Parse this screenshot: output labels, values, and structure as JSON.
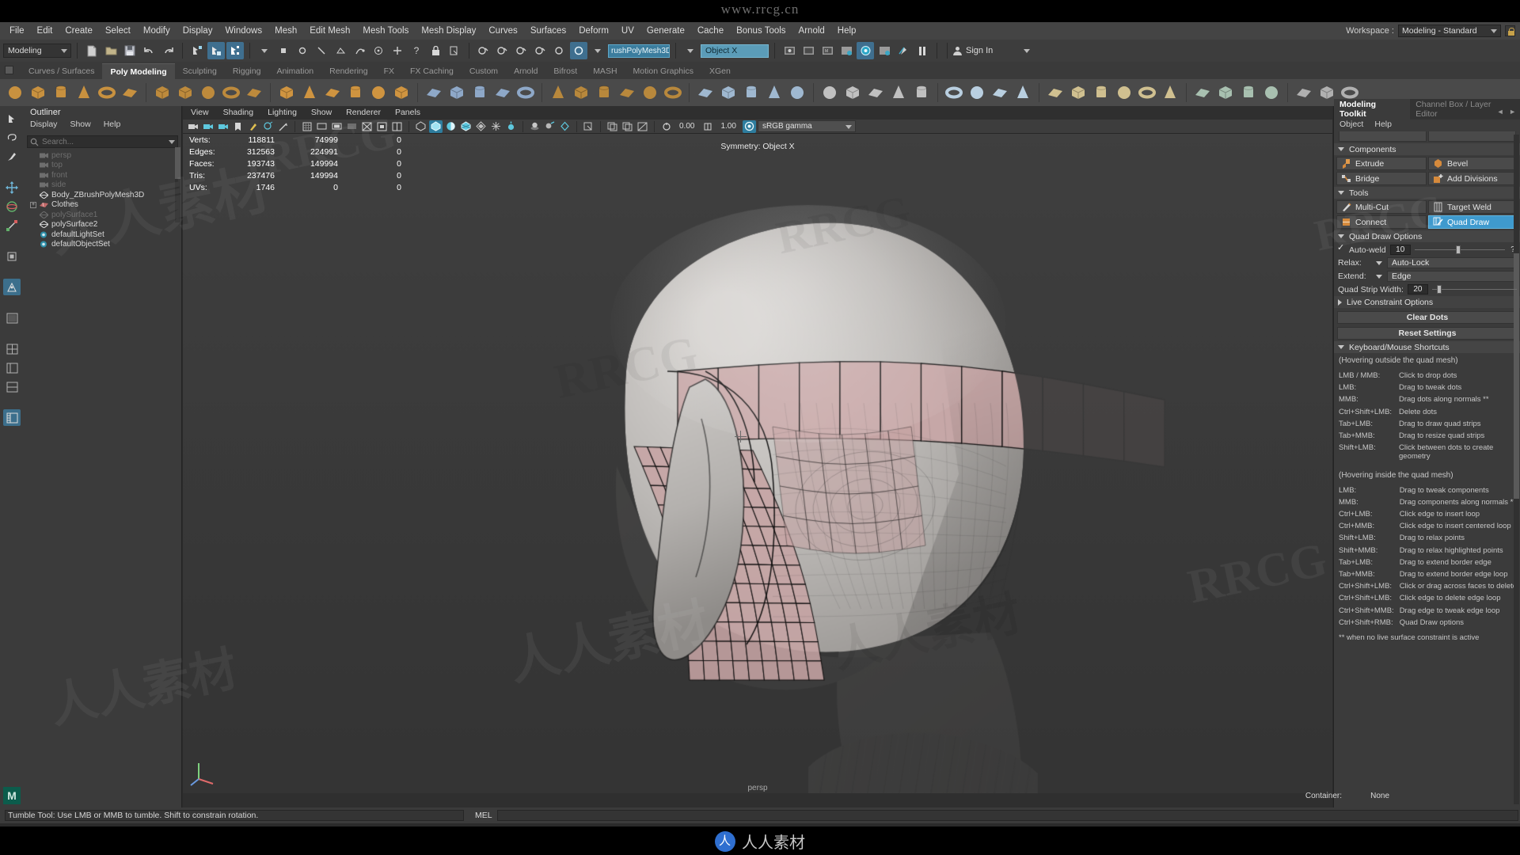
{
  "app": {
    "top_watermark": "www.rrcg.cn",
    "bottom_watermark": "人人素材"
  },
  "menubar": {
    "items": [
      "File",
      "Edit",
      "Create",
      "Select",
      "Modify",
      "Display",
      "Windows",
      "Mesh",
      "Edit Mesh",
      "Mesh Tools",
      "Mesh Display",
      "Curves",
      "Surfaces",
      "Deform",
      "UV",
      "Generate",
      "Cache",
      "Bonus Tools",
      "Arnold",
      "Help"
    ],
    "workspace_label": "Workspace :",
    "workspace_value": "Modeling - Standard"
  },
  "toolrow": {
    "mode": "Modeling",
    "name_field": "rushPolyMesh3D",
    "object_field": "Object X",
    "signin": "Sign In"
  },
  "shelf": {
    "tabs": [
      "Curves / Surfaces",
      "Poly Modeling",
      "Sculpting",
      "Rigging",
      "Animation",
      "Rendering",
      "FX",
      "FX Caching",
      "Custom",
      "Arnold",
      "Bifrost",
      "MASH",
      "Motion Graphics",
      "XGen"
    ],
    "active_tab": "Poly Modeling"
  },
  "outliner": {
    "title": "Outliner",
    "menus": [
      "Display",
      "Show",
      "Help"
    ],
    "search_placeholder": "Search...",
    "items": [
      {
        "label": "persp",
        "icon": "camera-icon",
        "dim": true,
        "expand": false
      },
      {
        "label": "top",
        "icon": "camera-icon",
        "dim": true,
        "expand": false
      },
      {
        "label": "front",
        "icon": "camera-icon",
        "dim": true,
        "expand": false
      },
      {
        "label": "side",
        "icon": "camera-icon",
        "dim": true,
        "expand": false
      },
      {
        "label": "Body_ZBrushPolyMesh3D",
        "icon": "mesh-icon",
        "dim": false,
        "expand": false
      },
      {
        "label": "Clothes",
        "icon": "group-icon",
        "dim": false,
        "expand": true
      },
      {
        "label": "polySurface1",
        "icon": "mesh-icon",
        "dim": true,
        "expand": false
      },
      {
        "label": "polySurface2",
        "icon": "mesh-icon",
        "dim": false,
        "expand": false
      },
      {
        "label": "defaultLightSet",
        "icon": "set-icon",
        "dim": false,
        "expand": false
      },
      {
        "label": "defaultObjectSet",
        "icon": "set-icon",
        "dim": false,
        "expand": false
      }
    ]
  },
  "viewport": {
    "menus": [
      "View",
      "Shading",
      "Lighting",
      "Show",
      "Renderer",
      "Panels"
    ],
    "exposure": "0.00",
    "gamma": "1.00",
    "color_management": "sRGB gamma",
    "symmetry_label": "Symmetry: Object X",
    "camera_label": "persp",
    "hud": {
      "columns": 3,
      "rows": [
        {
          "label": "Verts:",
          "total": "118811",
          "selected": "74999",
          "extra": "0"
        },
        {
          "label": "Edges:",
          "total": "312563",
          "selected": "224991",
          "extra": "0"
        },
        {
          "label": "Faces:",
          "total": "193743",
          "selected": "149994",
          "extra": "0"
        },
        {
          "label": "Tris:",
          "total": "237476",
          "selected": "149994",
          "extra": "0"
        },
        {
          "label": "UVs:",
          "total": "1746",
          "selected": "0",
          "extra": "0"
        }
      ]
    }
  },
  "modeling_toolkit": {
    "tab_active": "Modeling Toolkit",
    "tab_inactive": "Channel Box / Layer Editor",
    "menus": [
      "Object",
      "Help"
    ],
    "sections": {
      "components_title": "Components",
      "components_buttons": [
        {
          "label": "Extrude",
          "icon": "extrude-icon",
          "selected": false
        },
        {
          "label": "Bevel",
          "icon": "bevel-icon",
          "selected": false
        },
        {
          "label": "Bridge",
          "icon": "bridge-icon",
          "selected": false
        },
        {
          "label": "Add Divisions",
          "icon": "add-divisions-icon",
          "selected": false
        }
      ],
      "tools_title": "Tools",
      "tools_buttons": [
        {
          "label": "Multi-Cut",
          "icon": "multi-cut-icon",
          "selected": false
        },
        {
          "label": "Target Weld",
          "icon": "target-weld-icon",
          "selected": false
        },
        {
          "label": "Connect",
          "icon": "connect-icon",
          "selected": false
        },
        {
          "label": "Quad Draw",
          "icon": "quad-draw-icon",
          "selected": true
        }
      ],
      "quad_draw_title": "Quad Draw Options",
      "autoweld_label": "Auto-weld",
      "autoweld_value": "10",
      "autoweld_help": "?",
      "relax_label": "Relax:",
      "relax_value": "Auto-Lock",
      "extend_label": "Extend:",
      "extend_value": "Edge",
      "quadstrip_label": "Quad Strip Width:",
      "quadstrip_value": "20",
      "live_constraint_title": "Live Constraint Options",
      "clear_dots": "Clear Dots",
      "reset_settings": "Reset Settings",
      "shortcuts_title": "Keyboard/Mouse Shortcuts",
      "outside_note": "(Hovering outside the quad mesh)",
      "outside_shortcuts": [
        {
          "key": "LMB / MMB:",
          "action": "Click to drop dots"
        },
        {
          "key": "LMB:",
          "action": "Drag to tweak dots"
        },
        {
          "key": "MMB:",
          "action": "Drag dots along normals **"
        },
        {
          "key": "Ctrl+Shift+LMB:",
          "action": "Delete dots"
        },
        {
          "key": "Tab+LMB:",
          "action": "Drag to draw quad strips"
        },
        {
          "key": "Tab+MMB:",
          "action": "Drag to resize quad strips"
        },
        {
          "key": "Shift+LMB:",
          "action": "Click between dots to create geometry"
        }
      ],
      "inside_note": "(Hovering inside the quad mesh)",
      "inside_shortcuts": [
        {
          "key": "LMB:",
          "action": "Drag to tweak components"
        },
        {
          "key": "MMB:",
          "action": "Drag components along normals **"
        },
        {
          "key": "Ctrl+LMB:",
          "action": "Click edge to insert loop"
        },
        {
          "key": "Ctrl+MMB:",
          "action": "Click edge to insert centered loop"
        },
        {
          "key": "Shift+LMB:",
          "action": "Drag to relax points"
        },
        {
          "key": "Shift+MMB:",
          "action": "Drag to relax highlighted points"
        },
        {
          "key": "Tab+LMB:",
          "action": "Drag to extend border edge"
        },
        {
          "key": "Tab+MMB:",
          "action": "Drag to extend border edge loop"
        },
        {
          "key": "Ctrl+Shift+LMB:",
          "action": "Click or drag across faces to delete"
        },
        {
          "key": "Ctrl+Shift+LMB:",
          "action": "Click edge to delete edge loop"
        },
        {
          "key": "Ctrl+Shift+MMB:",
          "action": "Drag edge to tweak edge loop"
        },
        {
          "key": "Ctrl+Shift+RMB:",
          "action": "Quad Draw options"
        }
      ],
      "footnote": "** when no live surface constraint is active"
    }
  },
  "statusbar": {
    "message": "Tumble Tool: Use LMB or MMB to tumble. Shift to constrain rotation.",
    "mel_label": "MEL",
    "container_label": "Container:",
    "container_value": "None"
  },
  "colors": {
    "accent_blue": "#3f9ace",
    "panel_bg": "#3b3b3b",
    "toolbar_bg": "#4a4a4a",
    "selected_face": "#c9a8a8",
    "mesh_gray": "#b6b3b0"
  }
}
